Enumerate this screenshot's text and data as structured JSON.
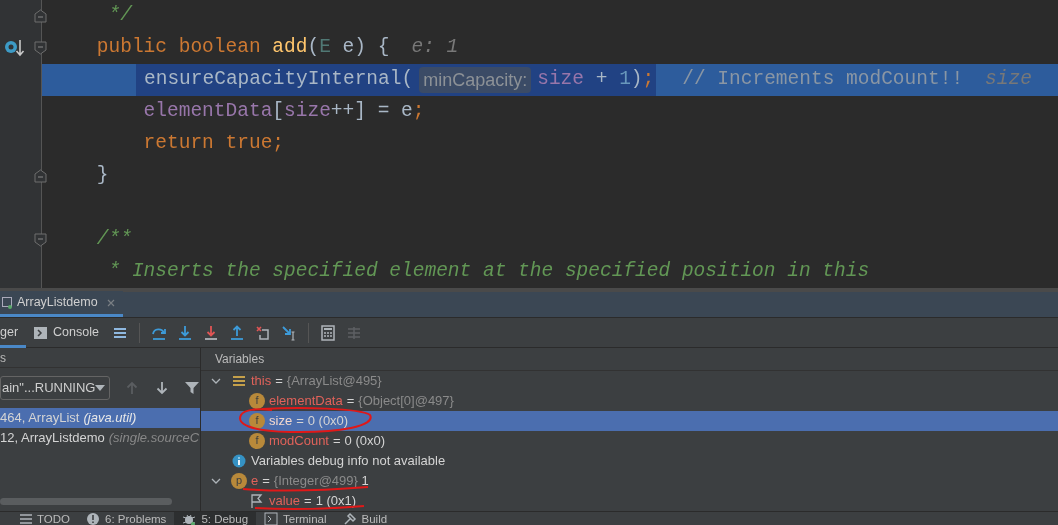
{
  "editor": {
    "lines": [
      {
        "kind": "code",
        "current": false,
        "gutter": [
          {
            "kind": "fold_end"
          }
        ],
        "segments": [
          {
            "kind": "code",
            "tokens": [
              {
                "t": "     */",
                "kind": "doc"
              }
            ]
          }
        ]
      },
      {
        "kind": "code",
        "current": false,
        "gutter": [
          {
            "kind": "execution_point"
          },
          {
            "kind": "fold_start"
          }
        ],
        "segments": [
          {
            "kind": "code",
            "tokens": [
              {
                "t": "    public boolean ",
                "kind": "keyword"
              },
              {
                "t": "add",
                "kind": "method"
              },
              {
                "t": "(",
                "kind": "plain"
              },
              {
                "t": "E",
                "kind": "typeparam"
              },
              {
                "t": " e) {",
                "kind": "plain"
              }
            ]
          },
          {
            "kind": "value_hint",
            "text": "e: 1"
          }
        ]
      },
      {
        "kind": "code",
        "current": true,
        "statement": [
          {
            "kind": "code",
            "tokens": [
              {
                "t": "ensureCapacityInternal(",
                "kind": "plain"
              }
            ]
          },
          {
            "kind": "param_hint",
            "text": "minCapacity:"
          },
          {
            "kind": "code",
            "tokens": [
              {
                "t": "size",
                "kind": "field"
              },
              {
                "t": " + ",
                "kind": "plain"
              },
              {
                "t": "1",
                "kind": "number"
              },
              {
                "t": ")",
                "kind": "plain"
              },
              {
                "t": ";",
                "kind": "keyword"
              }
            ]
          }
        ],
        "segments": [
          {
            "kind": "comment",
            "text": "// Increments modCount!!"
          },
          {
            "kind": "value_hint",
            "text": "size"
          }
        ]
      },
      {
        "kind": "code",
        "current": false,
        "segments": [
          {
            "kind": "code",
            "tokens": [
              {
                "t": "        elementData",
                "kind": "field"
              },
              {
                "t": "[",
                "kind": "plain"
              },
              {
                "t": "size",
                "kind": "field"
              },
              {
                "t": "++] = e",
                "kind": "plain"
              },
              {
                "t": ";",
                "kind": "keyword"
              }
            ]
          }
        ]
      },
      {
        "kind": "code",
        "current": false,
        "segments": [
          {
            "kind": "code",
            "tokens": [
              {
                "t": "        return true;",
                "kind": "keyword"
              }
            ]
          }
        ]
      },
      {
        "kind": "code",
        "current": false,
        "gutter": [
          {
            "kind": "fold_end"
          }
        ],
        "segments": [
          {
            "kind": "code",
            "tokens": [
              {
                "t": "    }",
                "kind": "plain"
              }
            ]
          }
        ]
      },
      {
        "kind": "blank"
      },
      {
        "kind": "code",
        "current": false,
        "gutter": [
          {
            "kind": "fold_start"
          }
        ],
        "segments": [
          {
            "kind": "code",
            "tokens": [
              {
                "t": "    /**",
                "kind": "doc"
              }
            ]
          }
        ]
      },
      {
        "kind": "code",
        "current": false,
        "segments": [
          {
            "kind": "code",
            "tokens": [
              {
                "t": "     * Inserts the specified element at the specified position in this",
                "kind": "doc"
              }
            ]
          }
        ]
      }
    ]
  },
  "debug": {
    "session_tab": {
      "label": "ArrayListdemo",
      "selected": true
    },
    "tabs": [
      {
        "label": "ger",
        "selected": true
      },
      {
        "label": "Console",
        "selected": false
      }
    ],
    "frames_header": "s",
    "thread": "ain\"...RUNNING",
    "frames": [
      {
        "method": "464, ArrayList",
        "location": "(java.util)",
        "selected": true
      },
      {
        "method": "12, ArrayListdemo",
        "location": "(single.sourceC",
        "selected": false
      }
    ],
    "variables_header": "Variables",
    "variables": [
      {
        "kind": "object",
        "name": "this",
        "eq": "=",
        "type": "{ArrayList@495}",
        "expanded": true,
        "selected": false,
        "children": [
          {
            "kind": "field",
            "icon": "f",
            "name": "elementData",
            "eq": "=",
            "type": "{Object[0]@497}",
            "selected": false
          },
          {
            "kind": "field",
            "icon": "f",
            "name": "size",
            "eq": "=",
            "value": "0 (0x0)",
            "selected": true
          },
          {
            "kind": "field",
            "icon": "f",
            "name": "modCount",
            "eq": "=",
            "value": "0 (0x0)",
            "selected": false
          }
        ]
      },
      {
        "kind": "info",
        "text": "Variables debug info not available",
        "selected": false
      },
      {
        "kind": "param",
        "icon": "p",
        "name": "e",
        "eq": "=",
        "type": "{Integer@499}",
        "value": "1",
        "expanded": true,
        "selected": false,
        "children": [
          {
            "kind": "primitive",
            "name": "value",
            "eq": "=",
            "value": "1 (0x1)",
            "selected": false
          }
        ]
      }
    ]
  },
  "status_bar": [
    {
      "label": "TODO",
      "selected": false
    },
    {
      "label": "6: Problems",
      "selected": false
    },
    {
      "label": "5: Debug",
      "selected": true
    },
    {
      "label": "Terminal",
      "selected": false
    },
    {
      "label": "Build",
      "selected": false
    }
  ]
}
